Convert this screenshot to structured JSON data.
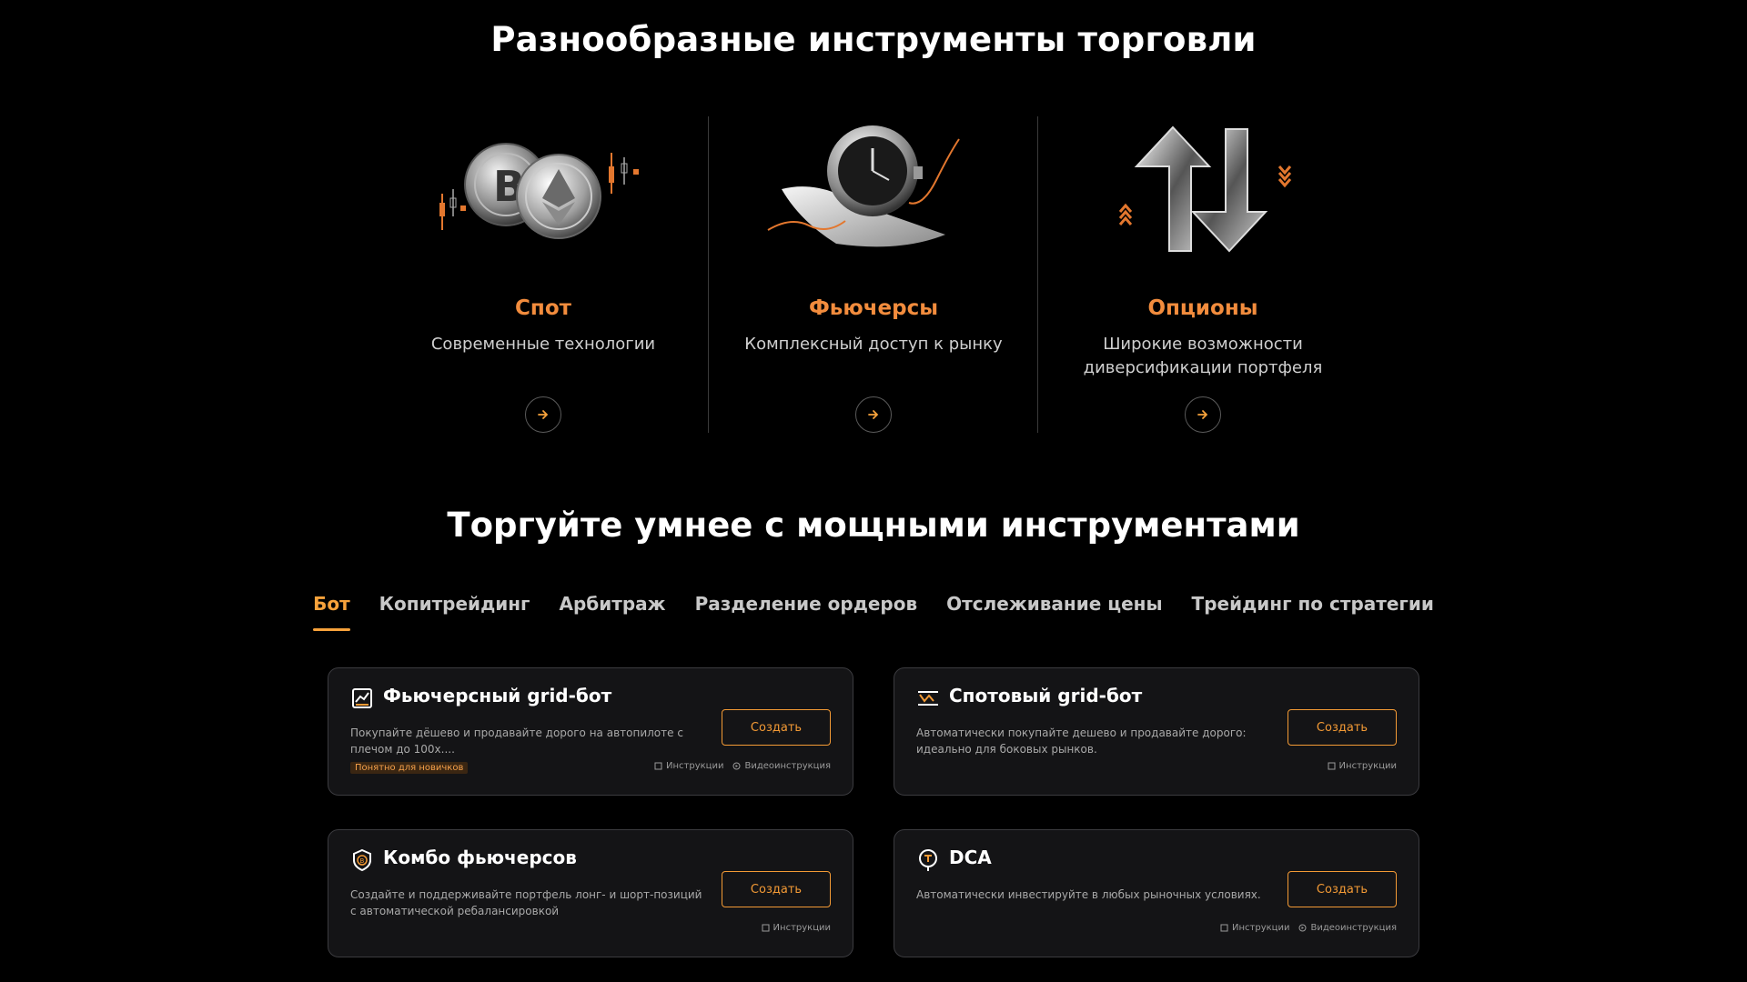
{
  "section1": {
    "title": "Разнообразные инструменты торговли"
  },
  "products": [
    {
      "name": "Спот",
      "desc": "Современные технологии",
      "icon": "crypto-coins-icon"
    },
    {
      "name": "Фьючерсы",
      "desc": "Комплексный доступ к рынку",
      "icon": "clock-chart-icon"
    },
    {
      "name": "Опционы",
      "desc": "Широкие возможности диверсификации портфеля",
      "icon": "up-down-arrows-icon"
    }
  ],
  "section2": {
    "title": "Торгуйте умнее с мощными инструментами"
  },
  "tabs": [
    {
      "label": "Бот",
      "active": true
    },
    {
      "label": "Копитрейдинг"
    },
    {
      "label": "Арбитраж"
    },
    {
      "label": "Разделение ордеров"
    },
    {
      "label": "Отслеживание цены"
    },
    {
      "label": "Трейдинг по стратегии"
    }
  ],
  "bots": {
    "futures_grid": {
      "name": "Фьючерсный grid-бот",
      "desc": "Покупайте дёшево и продавайте дорого на автопилоте с плечом до 100x....",
      "badge": "Понятно для новичков",
      "create": "Создать",
      "link_instructions": "Инструкции",
      "link_video": "Видеоинструкция"
    },
    "spot_grid": {
      "name": "Спотовый grid-бот",
      "desc": "Автоматически покупайте дешево и продавайте дорого: идеально для боковых рынков.",
      "create": "Создать",
      "link_instructions": "Инструкции"
    },
    "futures_combo": {
      "name": "Комбо фьючерсов",
      "desc": "Создайте и поддерживайте портфель лонг- и шорт-позиций с автоматической ребалансировкой",
      "create": "Создать",
      "link_instructions": "Инструкции"
    },
    "dca": {
      "name": "DCA",
      "desc": "Автоматически инвестируйте в любых рыночных условиях.",
      "create": "Создать",
      "link_instructions": "Инструкции",
      "link_video": "Видеоинструкция"
    }
  },
  "colors": {
    "accent": "#f7a23b",
    "product_name": "#f28c3d",
    "background": "#000000",
    "card_bg": "#141416"
  }
}
